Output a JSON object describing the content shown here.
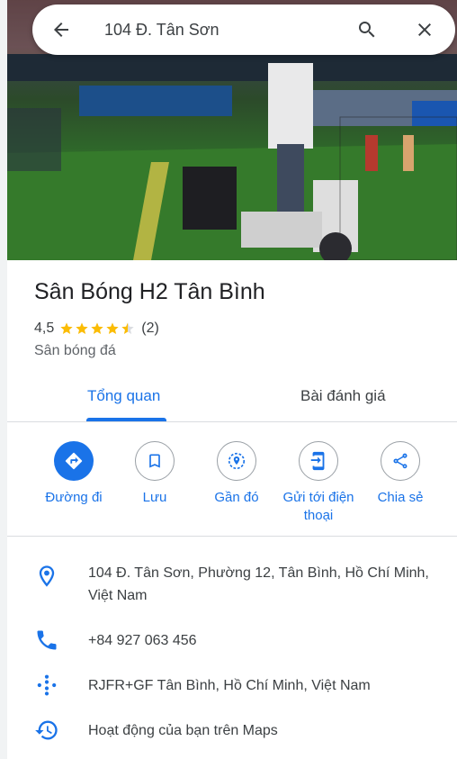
{
  "search": {
    "query": "104 Đ. Tân Sơn"
  },
  "place": {
    "name": "Sân Bóng H2 Tân Bình",
    "rating": "4,5",
    "stars": 4.5,
    "review_count": "(2)",
    "category": "Sân bóng đá"
  },
  "tabs": [
    {
      "label": "Tổng quan",
      "active": true
    },
    {
      "label": "Bài đánh giá",
      "active": false
    }
  ],
  "actions": [
    {
      "label": "Đường đi",
      "icon": "directions-icon"
    },
    {
      "label": "Lưu",
      "icon": "bookmark-icon"
    },
    {
      "label": "Gần đó",
      "icon": "nearby-icon"
    },
    {
      "label": "Gửi tới điện thoại",
      "icon": "send-to-phone-icon"
    },
    {
      "label": "Chia sẻ",
      "icon": "share-icon"
    }
  ],
  "details": {
    "address": "104 Đ. Tân Sơn, Phường 12, Tân Bình, Hồ Chí Minh, Việt Nam",
    "phone": "+84 927 063 456",
    "plus_code": "RJFR+GF Tân Bình, Hồ Chí Minh, Việt Nam",
    "activity": "Hoạt động của bạn trên Maps"
  },
  "colors": {
    "accent": "#1a73e8",
    "star": "#fbbc04",
    "text": "#202124",
    "muted": "#5f6368"
  }
}
